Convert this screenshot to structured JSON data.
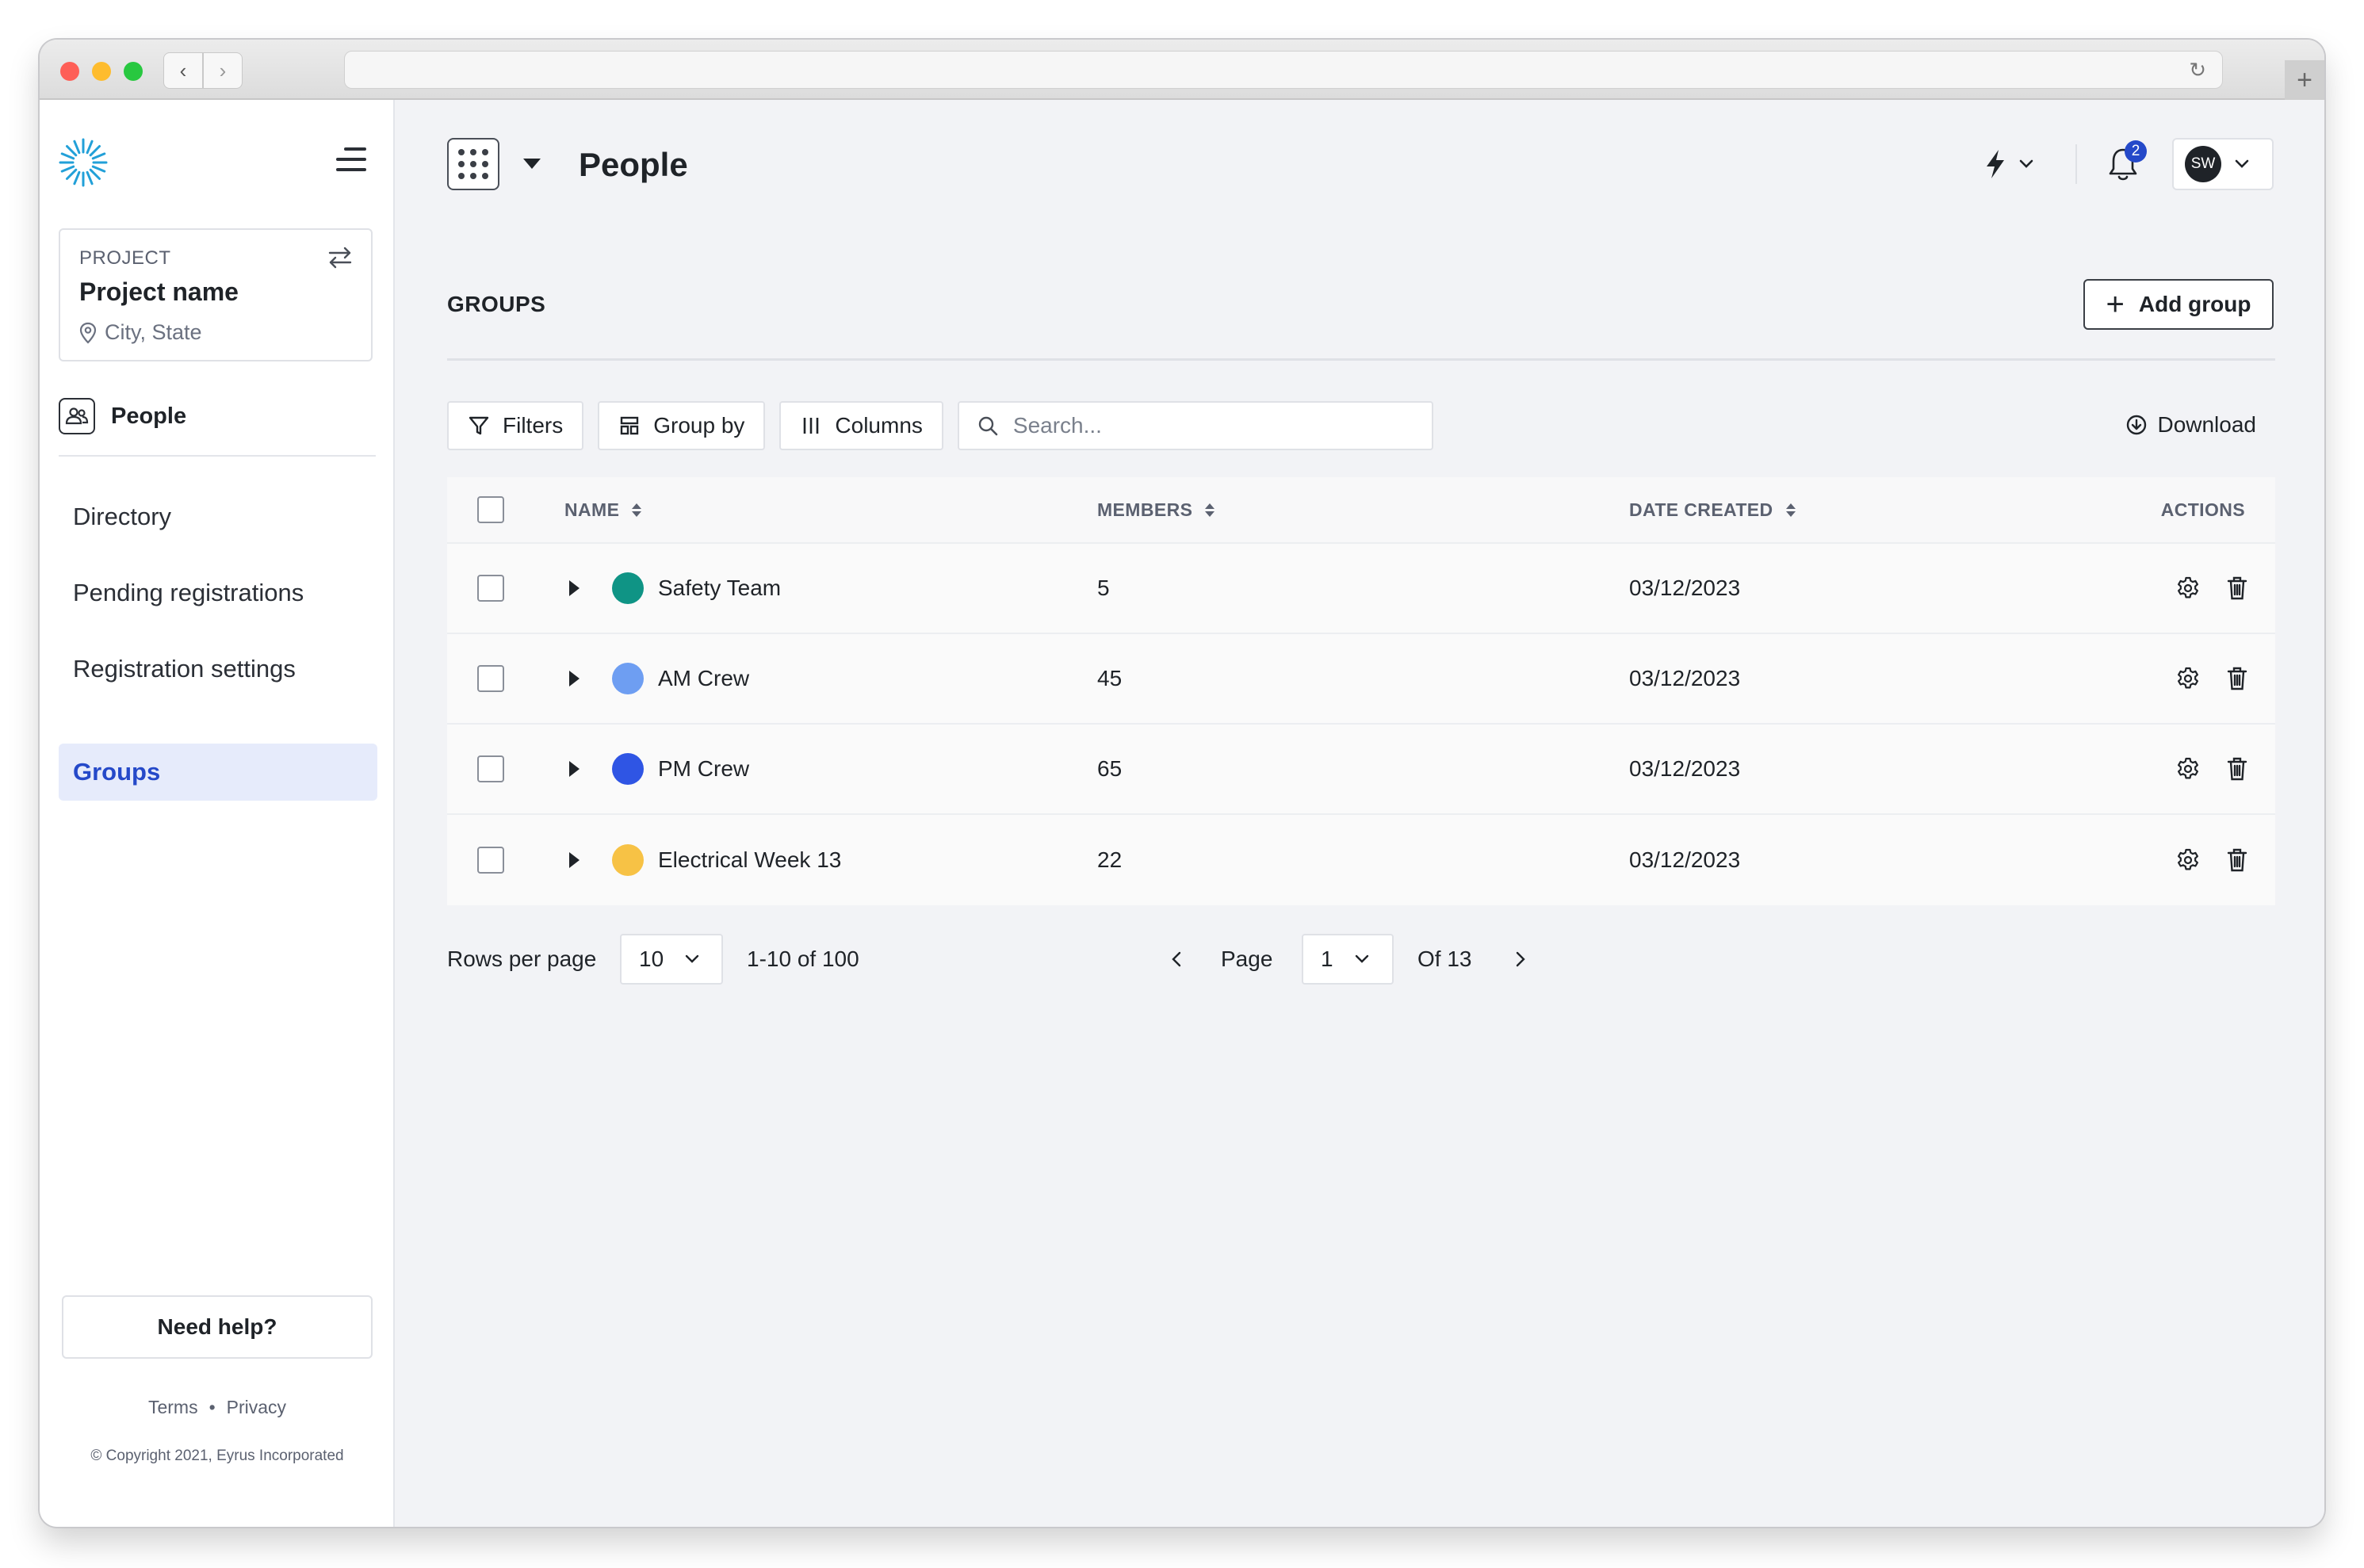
{
  "sidebar": {
    "project": {
      "label": "PROJECT",
      "name": "Project name",
      "location": "City, State"
    },
    "section_title": "People",
    "items": [
      {
        "label": "Directory",
        "active": false
      },
      {
        "label": "Pending registrations",
        "active": false
      },
      {
        "label": "Registration settings",
        "active": false
      },
      {
        "label": "Groups",
        "active": true
      }
    ],
    "help_label": "Need help?",
    "terms": "Terms",
    "privacy": "Privacy",
    "copyright": "© Copyright 2021, Eyrus Incorporated"
  },
  "header": {
    "title": "People",
    "notification_count": "2",
    "user_initials": "SW"
  },
  "main": {
    "section_title": "GROUPS",
    "add_group_label": "Add group",
    "toolbar": {
      "filters": "Filters",
      "group_by": "Group by",
      "columns": "Columns",
      "search_placeholder": "Search...",
      "download": "Download"
    },
    "table": {
      "columns": [
        "NAME",
        "MEMBERS",
        "DATE CREATED",
        "ACTIONS"
      ],
      "rows": [
        {
          "name": "Safety Team",
          "color": "#0f9485",
          "members": "5",
          "date": "03/12/2023"
        },
        {
          "name": "AM Crew",
          "color": "#6e9ef2",
          "members": "45",
          "date": "03/12/2023"
        },
        {
          "name": "PM Crew",
          "color": "#2f55e4",
          "members": "65",
          "date": "03/12/2023"
        },
        {
          "name": "Electrical Week 13",
          "color": "#f7c245",
          "members": "22",
          "date": "03/12/2023"
        }
      ]
    },
    "pagination": {
      "rows_per_page_label": "Rows per page",
      "rows_per_page": "10",
      "range": "1-10 of 100",
      "page_label": "Page",
      "page": "1",
      "of_pages": "Of 13"
    }
  },
  "colors": {
    "accent": "#2549c9",
    "active_bg": "#e6ebfb"
  }
}
